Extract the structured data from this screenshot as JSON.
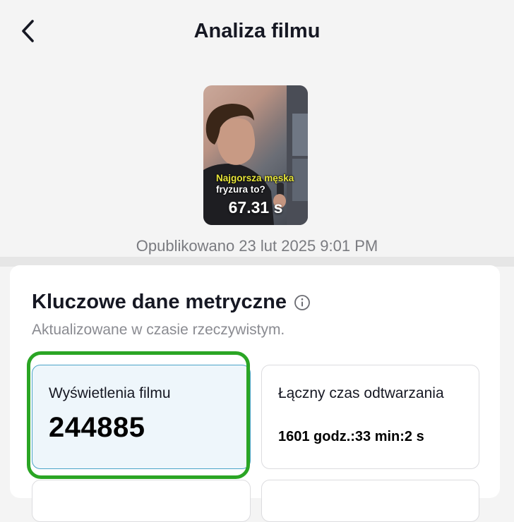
{
  "header": {
    "title": "Analiza filmu",
    "back_icon": "chevron-left-icon"
  },
  "video": {
    "caption_line1": "Najgorsza męska",
    "caption_line2": "fryzura to?",
    "duration": "67.31 s",
    "published": "Opublikowano 23 lut 2025 9:01 PM"
  },
  "metrics_section": {
    "title": "Kluczowe dane metryczne",
    "info_icon": "info-icon",
    "subtitle": "Aktualizowane w czasie rzeczywistym.",
    "highlight_color": "#2aa524",
    "cards": [
      {
        "label": "Wyświetlenia filmu",
        "value": "244885"
      },
      {
        "label": "Łączny czas odtwarzania",
        "value": "1601 godz.:33 min:2 s"
      }
    ]
  }
}
